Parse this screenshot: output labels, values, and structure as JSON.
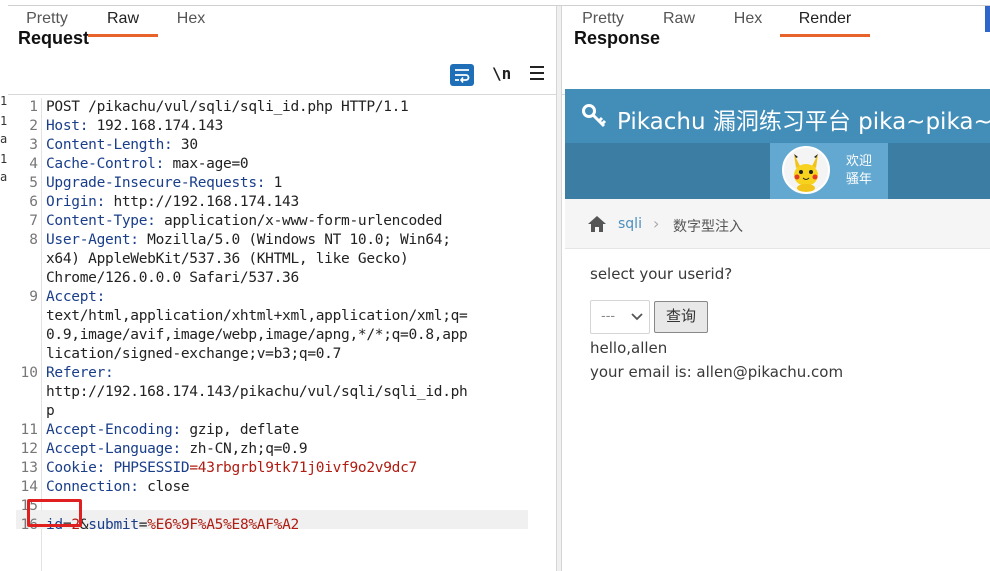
{
  "request": {
    "title": "Request",
    "tabs": [
      {
        "label": "Pretty",
        "active": false
      },
      {
        "label": "Raw",
        "active": true
      },
      {
        "label": "Hex",
        "active": false
      }
    ],
    "toolbar": {
      "wrap_icon": "word-wrap-icon",
      "newline_label": "\\n",
      "menu_icon": "hamburger-menu-icon"
    },
    "lines": [
      {
        "n": "1",
        "text": "POST /pikachu/vul/sqli/sqli_id.php HTTP/1.1"
      },
      {
        "n": "2",
        "key": "Host:",
        "val": " 192.168.174.143"
      },
      {
        "n": "3",
        "key": "Content-Length:",
        "val": " 30"
      },
      {
        "n": "4",
        "key": "Cache-Control:",
        "val": " max-age=0"
      },
      {
        "n": "5",
        "key": "Upgrade-Insecure-Requests:",
        "val": " 1"
      },
      {
        "n": "6",
        "key": "Origin:",
        "val": " http://192.168.174.143"
      },
      {
        "n": "7",
        "key": "Content-Type:",
        "val": " application/x-www-form-urlencoded"
      },
      {
        "n": "8",
        "key": "User-Agent:",
        "val": " Mozilla/5.0 (Windows NT 10.0; Win64;"
      },
      {
        "n": "",
        "text": "x64) AppleWebKit/537.36 (KHTML, like Gecko)"
      },
      {
        "n": "",
        "text": "Chrome/126.0.0.0 Safari/537.36"
      },
      {
        "n": "9",
        "key": "Accept:",
        "val": ""
      },
      {
        "n": "",
        "text": "text/html,application/xhtml+xml,application/xml;q="
      },
      {
        "n": "",
        "text": "0.9,image/avif,image/webp,image/apng,*/*;q=0.8,app"
      },
      {
        "n": "",
        "text": "lication/signed-exchange;v=b3;q=0.7"
      },
      {
        "n": "10",
        "key": "Referer:",
        "val": ""
      },
      {
        "n": "",
        "text": "http://192.168.174.143/pikachu/vul/sqli/sqli_id.ph"
      },
      {
        "n": "",
        "text": "p"
      },
      {
        "n": "11",
        "key": "Accept-Encoding:",
        "val": " gzip, deflate"
      },
      {
        "n": "12",
        "key": "Accept-Language:",
        "val": " zh-CN,zh;q=0.9"
      },
      {
        "n": "13",
        "key": "Cookie:",
        "cookie_name": " PHPSESSID",
        "cookie_val": "=43rbgrbl9tk71j0ivf9o2v9dc7"
      },
      {
        "n": "14",
        "key": "Connection:",
        "val": " close"
      },
      {
        "n": "15",
        "text": ""
      }
    ],
    "body_line": {
      "n": "16",
      "p1_key": "id",
      "p1_eq": "=",
      "p1_val": "2",
      "amp": "&",
      "p2_key": "submit",
      "p2_eq": "=",
      "p2_val": "%E6%9F%A5%E8%AF%A2"
    },
    "left_edge_fragments": [
      "1",
      "1",
      "a",
      "1",
      "a"
    ]
  },
  "response": {
    "title": "Response",
    "tabs": [
      {
        "label": "Pretty",
        "active": false
      },
      {
        "label": "Raw",
        "active": false
      },
      {
        "label": "Hex",
        "active": false
      },
      {
        "label": "Render",
        "active": true
      }
    ],
    "render": {
      "site_title": "Pikachu 漏洞练习平台 pika~pika~",
      "user_greeting_1": "欢迎",
      "user_greeting_2": "骚年",
      "breadcrumb_1": "sqli",
      "breadcrumb_sep": "›",
      "breadcrumb_2": "数字型注入",
      "prompt": "select your userid?",
      "select_value": "---",
      "query_button": "查询",
      "output_1": "hello,allen",
      "output_2": "your email is: allen@pikachu.com",
      "colors": {
        "header": "#438eb9",
        "nav": "#3b7da3",
        "user_box": "#62a8d1",
        "link": "#4c8fbd"
      }
    }
  },
  "colors": {
    "active_tab": "#e8632b",
    "header_key": "#1a3e8a",
    "value_red": "#b01c12",
    "highlight_box": "#e02020"
  }
}
